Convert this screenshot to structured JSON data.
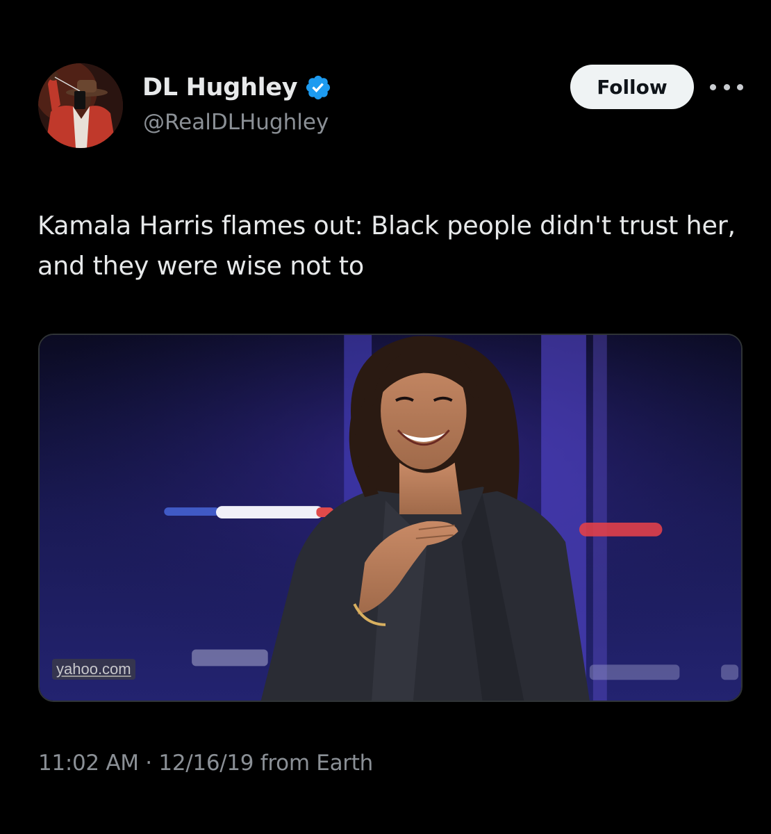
{
  "author": {
    "display_name": "DL Hughley",
    "handle": "@RealDLHughley",
    "verified": true,
    "avatar_icon": "avatar-photo"
  },
  "actions": {
    "follow_label": "Follow",
    "more_icon": "more-horizontal-icon"
  },
  "tweet": {
    "text": "Kamala Harris flames out: Black people didn't trust her, and they were wise not to",
    "media_watermark": "yahoo.com"
  },
  "meta": {
    "timestamp": "11:02 AM · 12/16/19 from Earth"
  },
  "colors": {
    "background": "#000000",
    "primary_text": "#e7e9ea",
    "secondary_text": "#8b9096",
    "verified_blue": "#1d9bf0",
    "follow_bg": "#eff3f4"
  }
}
